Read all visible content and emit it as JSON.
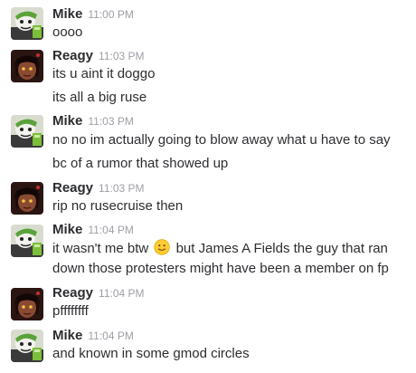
{
  "messages": [
    {
      "author": "Mike",
      "time": "11:00 PM",
      "avatar": "mike-avatar",
      "lines": [
        "oooo"
      ]
    },
    {
      "author": "Reagy",
      "time": "11:03 PM",
      "avatar": "reagy-avatar",
      "lines": [
        "its u aint it doggo",
        "its all a big ruse"
      ]
    },
    {
      "author": "Mike",
      "time": "11:03 PM",
      "avatar": "mike-avatar",
      "lines": [
        "no no im actually going to blow away what u have to say",
        "bc of a rumor that showed up"
      ]
    },
    {
      "author": "Reagy",
      "time": "11:03 PM",
      "avatar": "reagy-avatar",
      "lines": [
        "rip no rusecruise then"
      ]
    },
    {
      "author": "Mike",
      "time": "11:04 PM",
      "avatar": "mike-avatar",
      "lines_rich": {
        "before": "it wasn't me btw",
        "emoji": "slightly-smiling-face-emoji",
        "after": "but James A Fields the guy that ran"
      },
      "lines": [
        "down those protesters might have been a member on fp"
      ]
    },
    {
      "author": "Reagy",
      "time": "11:04 PM",
      "avatar": "reagy-avatar",
      "lines": [
        "pffffffff"
      ]
    },
    {
      "author": "Mike",
      "time": "11:04 PM",
      "avatar": "mike-avatar",
      "lines": [
        "and known in some gmod circles"
      ]
    }
  ],
  "colors": {
    "author": "#2c2d30",
    "timestamp": "#9e9ea6",
    "text": "#2c2d30"
  }
}
